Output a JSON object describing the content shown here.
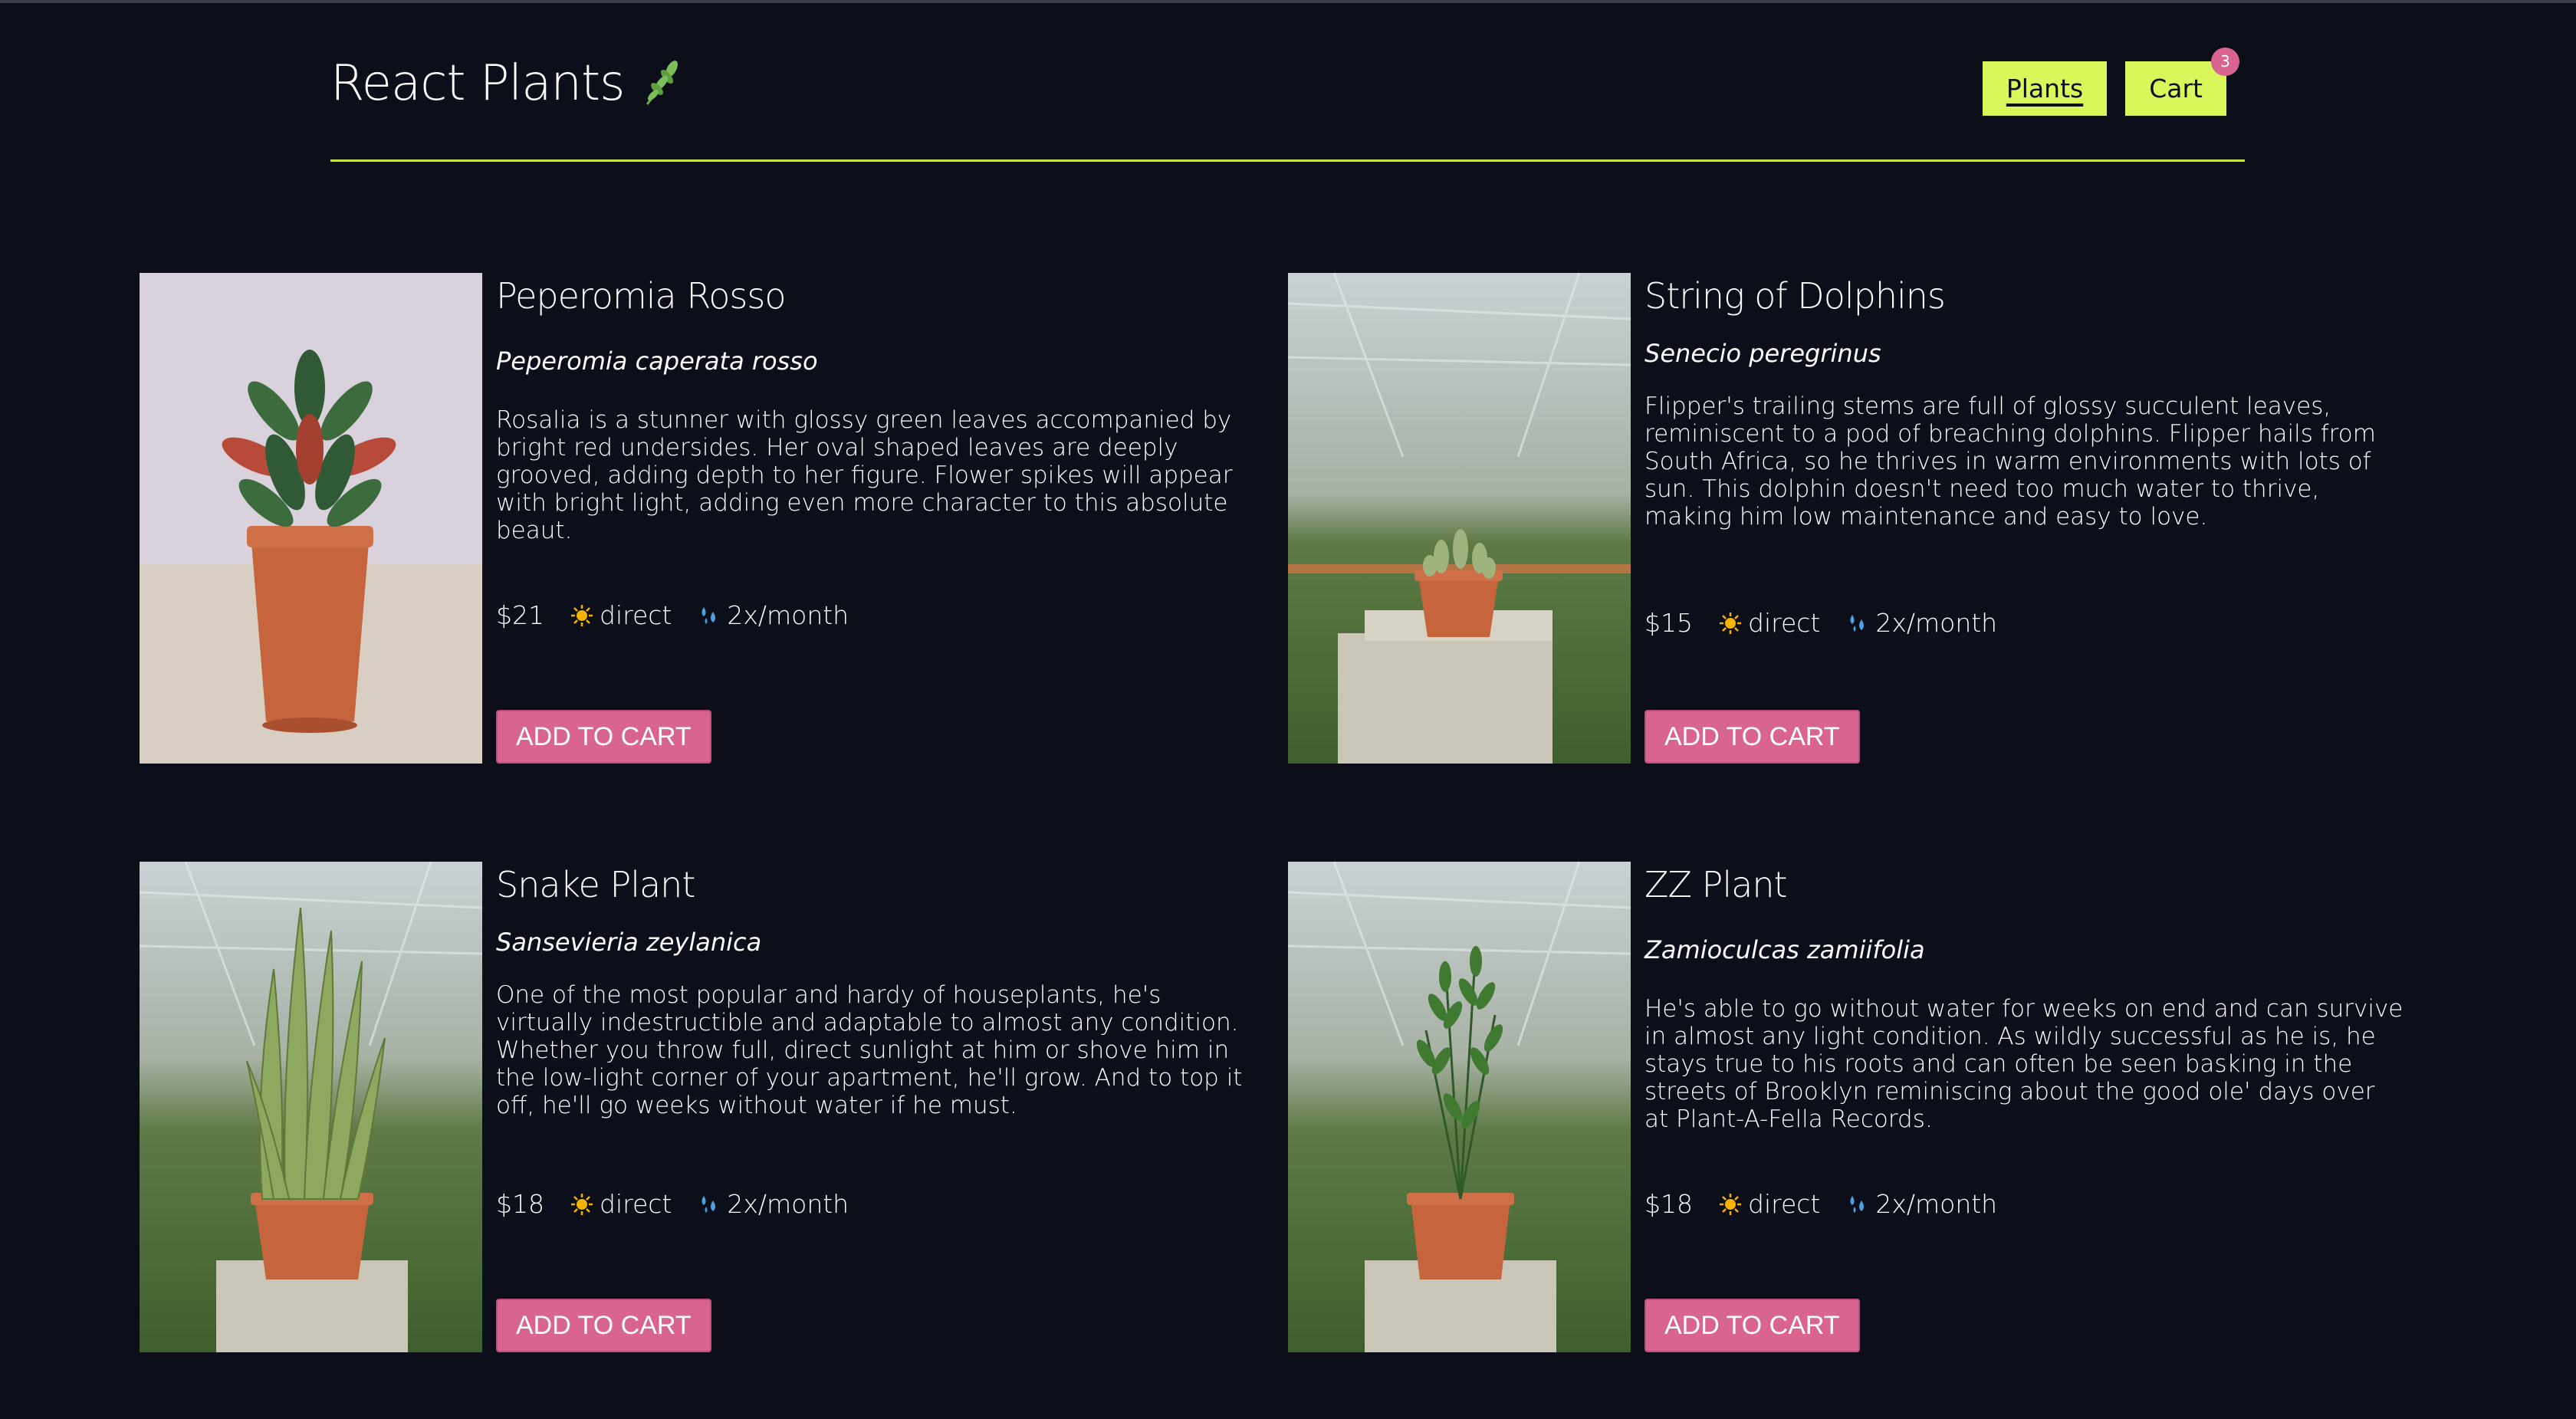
{
  "brand": {
    "title": "React Plants",
    "icon": "herb-leaf-icon"
  },
  "nav": {
    "plants_label": "Plants",
    "cart_label": "Cart",
    "cart_count": "3"
  },
  "colors": {
    "background": "#0c0f1a",
    "accent": "#d9f75a",
    "button": "#d9648f",
    "divider": "#c6e544"
  },
  "plants": [
    {
      "name": "Peperomia Rosso",
      "botanical": "Peperomia caperata rosso",
      "description": "Rosalia is a stunner with glossy green leaves accompanied by bright red undersides. Her oval shaped leaves are deeply grooved, adding depth to her figure. Flower spikes will appear with bright light, adding even more character to this absolute beaut.",
      "price": "$21",
      "light": "direct",
      "water": "2x/month",
      "button": "ADD TO CART"
    },
    {
      "name": "String of Dolphins",
      "botanical": "Senecio peregrinus",
      "description": "Flipper's trailing stems are full of glossy succulent leaves, reminiscent to a pod of breaching dolphins. Flipper hails from South Africa, so he thrives in warm environments with lots of sun. This dolphin doesn't need too much water to thrive, making him low maintenance and easy to love.",
      "price": "$15",
      "light": "direct",
      "water": "2x/month",
      "button": "ADD TO CART"
    },
    {
      "name": "Snake Plant",
      "botanical": "Sansevieria zeylanica",
      "description": "One of the most popular and hardy of houseplants, he's virtually indestructible and adaptable to almost any condition. Whether you throw full, direct sunlight at him or shove him in the low-light corner of your apartment, he'll grow. And to top it off, he'll go weeks without water if he must.",
      "price": "$18",
      "light": "direct",
      "water": "2x/month",
      "button": "ADD TO CART"
    },
    {
      "name": "ZZ Plant",
      "botanical": "Zamioculcas zamiifolia",
      "description": "He's able to go without water for weeks on end and can survive in almost any light condition. As wildly successful as he is, he stays true to his roots and can often be seen basking in the streets of Brooklyn reminiscing about the good ole' days over at Plant-A-Fella Records.",
      "price": "$18",
      "light": "direct",
      "water": "2x/month",
      "button": "ADD TO CART"
    }
  ]
}
